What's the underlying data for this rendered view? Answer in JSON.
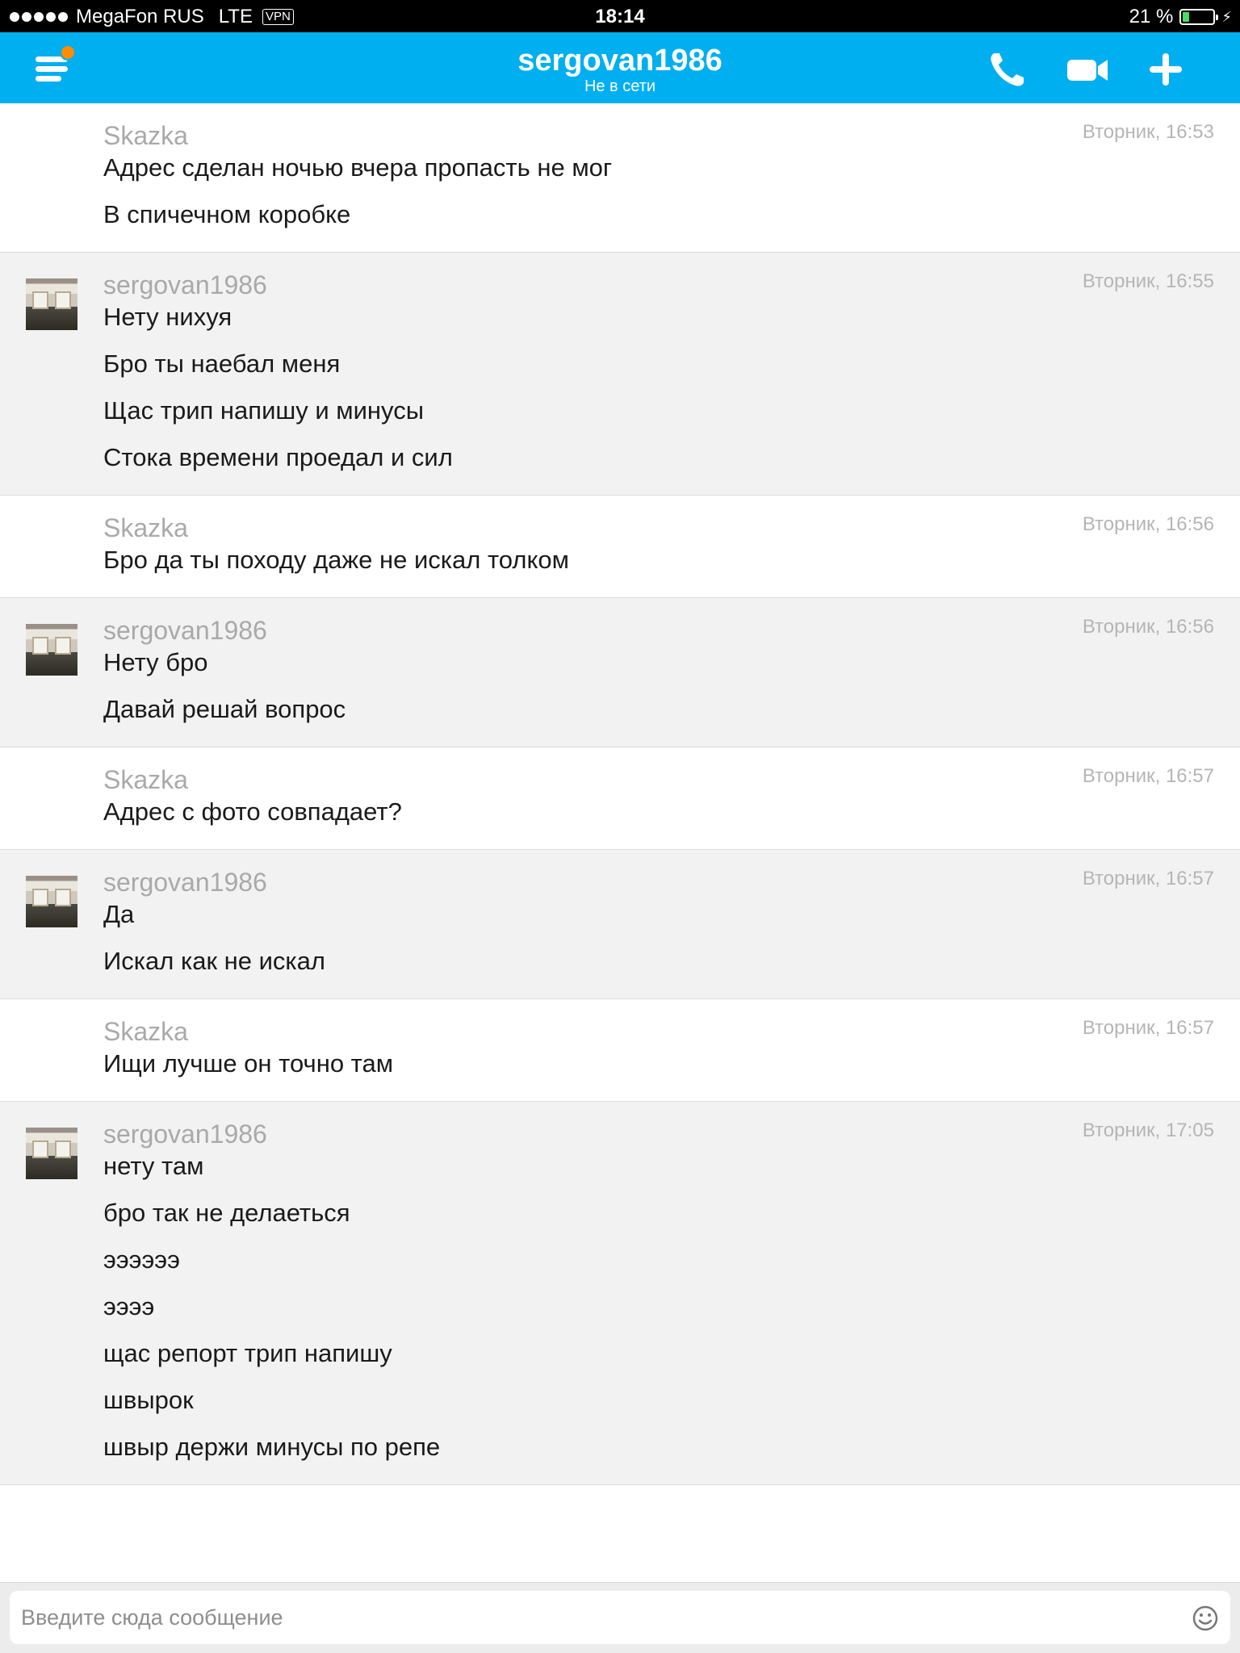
{
  "status_bar": {
    "carrier": "MegaFon RUS",
    "network": "LTE",
    "vpn": "VPN",
    "time": "18:14",
    "battery_text": "21 %",
    "battery_level": 0.21
  },
  "header": {
    "contact_name": "sergovan1986",
    "status": "Не в сети",
    "accent_color": "#00aff0",
    "icons": [
      "menu-icon",
      "phone-icon",
      "video-icon",
      "plus-icon"
    ]
  },
  "messages": [
    {
      "sender": "Skazka",
      "time": "Вторник, 16:53",
      "lines": [
        "Адрес сделан ночью вчера пропасть не мог",
        "В спичечном коробке"
      ]
    },
    {
      "sender": "sergovan1986",
      "time": "Вторник, 16:55",
      "lines": [
        "Нету нихуя",
        "Бро ты наебал меня",
        "Щас трип напишу и минусы",
        "Стока времени проедал и сил"
      ]
    },
    {
      "sender": "Skazka",
      "time": "Вторник, 16:56",
      "lines": [
        "Бро да ты походу даже не искал толком"
      ]
    },
    {
      "sender": "sergovan1986",
      "time": "Вторник, 16:56",
      "lines": [
        "Нету бро",
        "Давай решай вопрос"
      ]
    },
    {
      "sender": "Skazka",
      "time": "Вторник, 16:57",
      "lines": [
        "Адрес с фото совпадает?"
      ]
    },
    {
      "sender": "sergovan1986",
      "time": "Вторник, 16:57",
      "lines": [
        "Да",
        "Искал как не искал"
      ]
    },
    {
      "sender": "Skazka",
      "time": "Вторник, 16:57",
      "lines": [
        "Ищи лучше он точно там"
      ]
    },
    {
      "sender": "sergovan1986",
      "time": "Вторник, 17:05",
      "lines": [
        "нету там",
        "бро так не делаеться",
        "ээээээ",
        "ээээ",
        "щас репорт трип напишу",
        "швырок",
        "швыр держи минусы по репе"
      ]
    }
  ],
  "composer": {
    "placeholder": "Введите сюда сообщение"
  }
}
